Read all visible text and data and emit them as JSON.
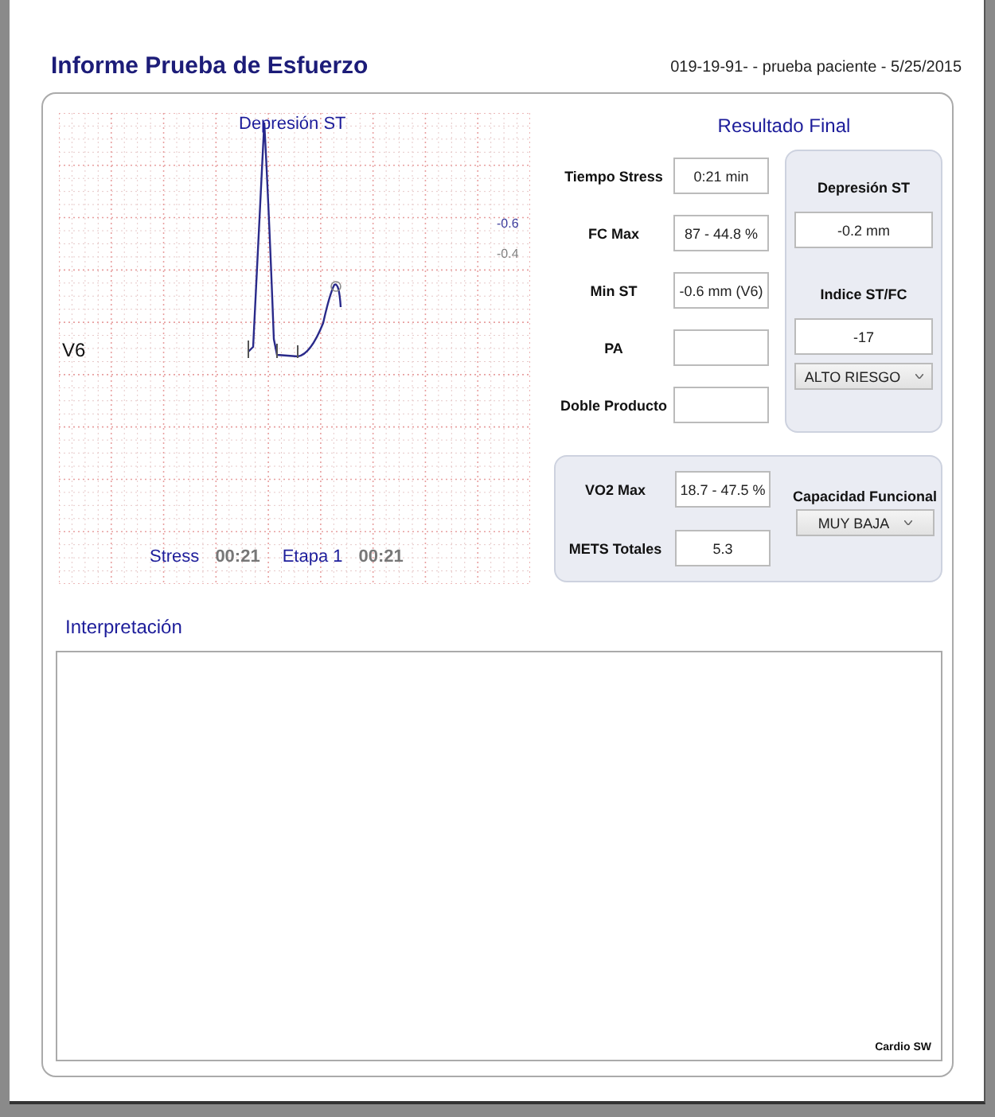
{
  "report": {
    "title": "Informe Prueba de Esfuerzo",
    "patient": "019-19-91- - prueba paciente - 5/25/2015"
  },
  "st_chart": {
    "title": "Depresión ST",
    "lead": "V6",
    "scale_labels": [
      {
        "text": "-0.6",
        "color": "#3a3a9a"
      },
      {
        "text": "-0.4",
        "color": "#808080"
      }
    ],
    "footer": [
      {
        "label": "Stress",
        "time": "00:21"
      },
      {
        "label": "Etapa 1",
        "time": "00:21"
      }
    ]
  },
  "results": {
    "title": "Resultado Final",
    "fields": [
      {
        "label": "Tiempo Stress",
        "value": "0:21 min"
      },
      {
        "label": "FC Max",
        "value": "87 - 44.8 %"
      },
      {
        "label": "Min ST",
        "value": "-0.6 mm (V6)"
      },
      {
        "label": "PA"
      },
      {
        "label": "Doble Producto"
      }
    ],
    "st_panel": {
      "depression_label": "Depresión ST",
      "depression_value": "-0.2 mm",
      "index_label": "Indice ST/FC",
      "index_value": "-17",
      "risk": "ALTO RIESGO"
    },
    "capacity": {
      "fields": [
        {
          "label": "VO2 Max",
          "value": "18.7 - 47.5 %"
        },
        {
          "label": "METS Totales",
          "value": "5.3"
        }
      ],
      "label": "Capacidad Funcional",
      "level": "MUY BAJA"
    }
  },
  "interpretation": {
    "title": "Interpretación",
    "footer": "Cardio SW"
  }
}
